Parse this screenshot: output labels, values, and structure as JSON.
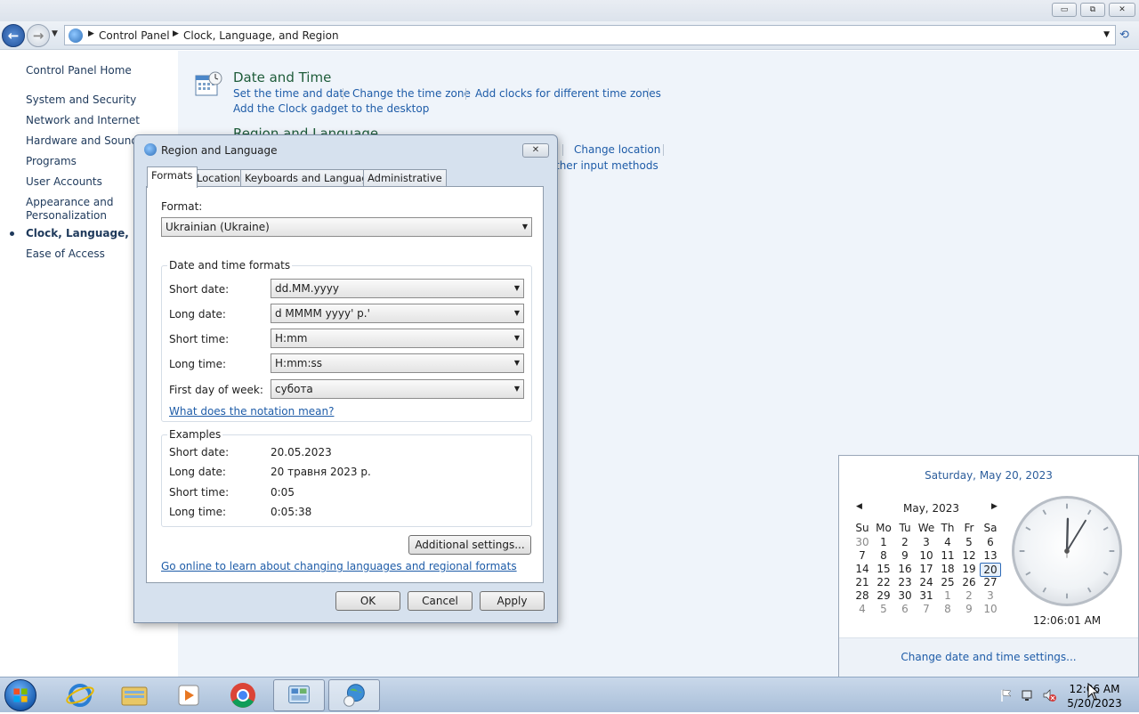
{
  "window": {
    "title_buttons": {
      "minimize": "▭",
      "restore": "⧉",
      "close": "✕"
    }
  },
  "address_bar": {
    "breadcrumbs": [
      "Control Panel",
      "Clock, Language, and Region"
    ],
    "back_glyph": "←",
    "forward_glyph": "→",
    "refresh_glyph": "⟲"
  },
  "sidebar": {
    "home": "Control Panel Home",
    "items": [
      {
        "label": "System and Security"
      },
      {
        "label": "Network and Internet"
      },
      {
        "label": "Hardware and Sound"
      },
      {
        "label": "Programs"
      },
      {
        "label": "User Accounts"
      },
      {
        "label": "Appearance and Personalization"
      },
      {
        "label": "Clock, Language, and I"
      },
      {
        "label": "Ease of Access"
      }
    ]
  },
  "categories": {
    "date_time": {
      "title": "Date and Time",
      "links": [
        "Set the time and date",
        "Change the time zone",
        "Add clocks for different time zones",
        "Add the Clock gadget to the desktop"
      ]
    },
    "region": {
      "title": "Region and Language",
      "links": [
        "Change location",
        "ther input methods"
      ]
    }
  },
  "dialog": {
    "title": "Region and Language",
    "close": "✕",
    "tabs": [
      "Formats",
      "Location",
      "Keyboards and Languages",
      "Administrative"
    ],
    "format_label": "Format:",
    "format_value": "Ukrainian (Ukraine)",
    "date_time_group": "Date and time formats",
    "fields": [
      {
        "label": "Short date:",
        "value": "dd.MM.yyyy"
      },
      {
        "label": "Long date:",
        "value": "d MMMM yyyy' р.'"
      },
      {
        "label": "Short time:",
        "value": "H:mm"
      },
      {
        "label": "Long time:",
        "value": "H:mm:ss"
      },
      {
        "label": "First day of week:",
        "value": "субота"
      }
    ],
    "notation_link": "What does the notation mean?",
    "examples_group": "Examples",
    "examples": [
      {
        "label": "Short date:",
        "value": "20.05.2023"
      },
      {
        "label": "Long date:",
        "value": "20 травня 2023 р."
      },
      {
        "label": "Short time:",
        "value": "0:05"
      },
      {
        "label": "Long time:",
        "value": "0:05:38"
      }
    ],
    "additional_settings": "Additional settings...",
    "online_link": "Go online to learn about changing languages and regional formats",
    "ok": "OK",
    "cancel": "Cancel",
    "apply": "Apply"
  },
  "calendar": {
    "full_date": "Saturday, May 20, 2023",
    "month": "May, 2023",
    "prev": "◀",
    "next": "▶",
    "weekdays": [
      "Su",
      "Mo",
      "Tu",
      "We",
      "Th",
      "Fr",
      "Sa"
    ],
    "weeks": [
      [
        "30",
        "1",
        "2",
        "3",
        "4",
        "5",
        "6"
      ],
      [
        "7",
        "8",
        "9",
        "10",
        "11",
        "12",
        "13"
      ],
      [
        "14",
        "15",
        "16",
        "17",
        "18",
        "19",
        "20"
      ],
      [
        "21",
        "22",
        "23",
        "24",
        "25",
        "26",
        "27"
      ],
      [
        "28",
        "29",
        "30",
        "31",
        "1",
        "2",
        "3"
      ],
      [
        "4",
        "5",
        "6",
        "7",
        "8",
        "9",
        "10"
      ]
    ],
    "today": "20",
    "clock_time": "12:06:01 AM",
    "change_link": "Change date and time settings..."
  },
  "taskbar": {
    "time": "12:06 AM",
    "date": "5/20/2023",
    "apps": [
      "start-orb",
      "internet-explorer",
      "windows-explorer",
      "media-player",
      "chrome",
      "control-panel",
      "region-and-language"
    ]
  }
}
